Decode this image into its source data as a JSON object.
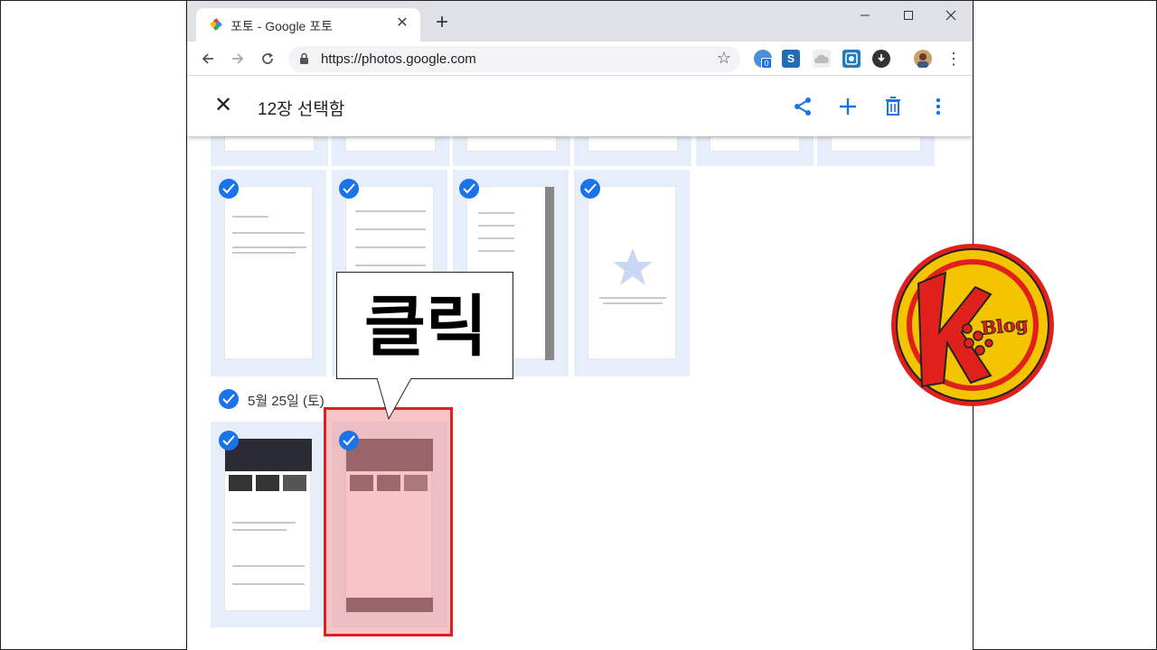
{
  "browser": {
    "tab_title": "포토 - Google 포토",
    "tab_close": "✕",
    "new_tab": "+",
    "url": "https://photos.google.com",
    "extension_badge": "0"
  },
  "selection_bar": {
    "close_label": "✕",
    "count_text": "12장 선택함"
  },
  "photos": {
    "date_header": "5월 25일 (토)"
  },
  "annotation": {
    "callout_text": "클릭"
  },
  "logo": {
    "letter": "K",
    "word": "Blog"
  },
  "colors": {
    "accent": "#1a73e8",
    "highlight": "#e02020",
    "logo_fill": "#f5c400",
    "logo_red": "#e0201a"
  }
}
